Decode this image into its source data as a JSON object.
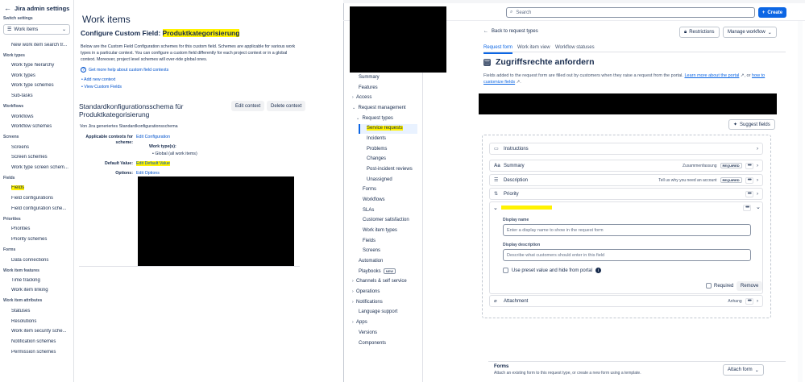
{
  "sidebar": {
    "back_label": "Jira admin settings",
    "switch_label": "Switch settings",
    "select_value": "Work items",
    "sections": [
      {
        "head": "",
        "items": [
          "New work item search tr..."
        ]
      },
      {
        "head": "Work types",
        "items": [
          "Work type hierarchy",
          "Work types",
          "Work type schemes",
          "Sub-tasks"
        ]
      },
      {
        "head": "Workflows",
        "items": [
          "Workflows",
          "Workflow schemes"
        ]
      },
      {
        "head": "Screens",
        "items": [
          "Screens",
          "Screen schemes",
          "Work type screen schem..."
        ]
      },
      {
        "head": "Fields",
        "items": [
          "Fields",
          "Field configurations",
          "Field configuration sche..."
        ]
      },
      {
        "head": "Priorities",
        "items": [
          "Priorities",
          "Priority schemes"
        ]
      },
      {
        "head": "Forms",
        "items": [
          "Data connections"
        ]
      },
      {
        "head": "Work item features",
        "items": [
          "Time tracking",
          "Work item linking"
        ]
      },
      {
        "head": "Work item attributes",
        "items": [
          "Statuses",
          "Resolutions",
          "Work item security sche...",
          "Notification schemes",
          "Permission schemes"
        ]
      }
    ]
  },
  "middle": {
    "page_title": "Work items",
    "config_prefix": "Configure Custom Field: ",
    "config_field": "Produktkategorisierung",
    "description": "Below are the Custom Field Configuration schemes for this custom field. Schemes are applicable for various work types in a particular context. You can configure a custom field differently for each project context or in a global context. Moreover, project level schemes will over-ride global ones.",
    "help_link": "Get more help about custom field contexts",
    "add_context": "Add new context",
    "view_fields": "View Custom Fields",
    "scheme_title": "Standardkonfigurationsschema für Produktkategorisierung",
    "edit_context": "Edit context",
    "delete_context": "Delete context",
    "scheme_sub": "Von Jira generiertes Standardkonfigurationsschema",
    "applicable_label": "Applicable contexts for scheme:",
    "edit_configuration": "Edit Configuration",
    "work_types_label": "Work type(s):",
    "work_types_value": "Global (all work items)",
    "default_value_label": "Default Value:",
    "edit_default_value": "Edit Default Value",
    "options_label": "Options:",
    "edit_options": "Edit Options"
  },
  "right": {
    "search_placeholder": "Search",
    "create_label": "Create",
    "nav": {
      "summary": "Summary",
      "features": "Features",
      "access": "Access",
      "request_management": "Request management",
      "request_types": "Request types",
      "service_requests": "Service requests",
      "incidents": "Incidents",
      "problems": "Problems",
      "changes": "Changes",
      "post_incident": "Post-incident reviews",
      "unassigned": "Unassigned",
      "forms": "Forms",
      "workflows": "Workflows",
      "slas": "SLAs",
      "customer_satisfaction": "Customer satisfaction",
      "work_item_types": "Work item types",
      "fields": "Fields",
      "screens": "Screens",
      "automation": "Automation",
      "playbooks": "Playbooks",
      "new_badge": "NEW",
      "channels": "Channels & self service",
      "operations": "Operations",
      "notifications": "Notifications",
      "language_support": "Language support",
      "apps": "Apps",
      "versions": "Versions",
      "components": "Components"
    },
    "back_link": "Back to request types",
    "restrictions": "Restrictions",
    "manage_workflow": "Manage workflow",
    "tabs": [
      "Request form",
      "Work item view",
      "Workflow statuses"
    ],
    "title": "Zugriffsrechte anfordern",
    "desc_prefix": "Fields added to the request form are filled out by customers when they raise a request from the portal. ",
    "desc_link1": "Learn more about the portal",
    "desc_mid": ", or ",
    "desc_link2": "how to customize fields",
    "suggest_fields": "Suggest fields",
    "rows": {
      "instructions": "Instructions",
      "summary": "Summary",
      "summary_display": "Zusammenfassung",
      "description": "Description",
      "description_display": "Tell us why you need an account",
      "required_badge": "REQUIRED",
      "priority": "Priority",
      "attachment": "Attachment",
      "attachment_display": "Anhang"
    },
    "expanded": {
      "display_name_label": "Display name",
      "display_name_placeholder": "Enter a display name to show in the request form",
      "display_desc_label": "Display description",
      "display_desc_placeholder": "Describe what customers should enter in this field",
      "preset_label": "Use preset value and hide from portal",
      "required_label": "Required",
      "remove_label": "Remove"
    },
    "forms_title": "Forms",
    "forms_desc": "Attach an existing form to this request type, or create a new form using a template.",
    "attach_form": "Attach form"
  }
}
